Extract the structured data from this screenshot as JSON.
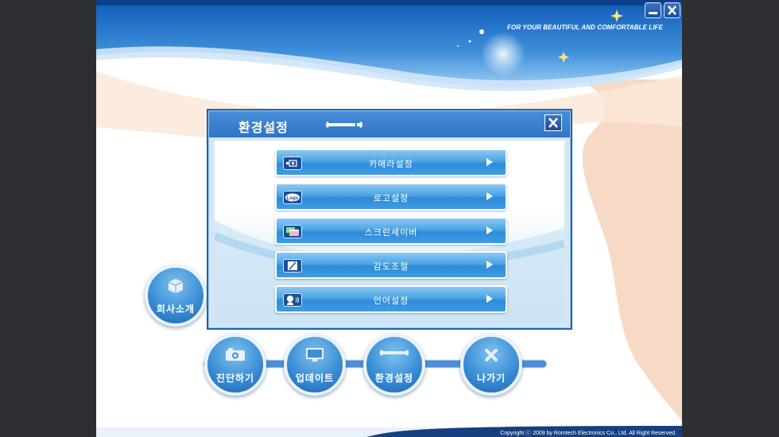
{
  "app": {
    "tagline": "FOR YOUR BEAUTIFUL AND COMFORTABLE LIFE",
    "copyright": "Copyright ⓒ 2009 by Romtech Electronics Co., Ltd.   All Right Reserved."
  },
  "window_controls": [
    {
      "name": "minimize",
      "icon": "minimize-icon"
    },
    {
      "name": "close",
      "icon": "close-icon"
    }
  ],
  "dialog": {
    "title": "환경설정",
    "title_icon": "wrench-icon",
    "close_icon": "close-icon",
    "items": [
      {
        "label": "카메라설정",
        "icon": "camera-setting-icon"
      },
      {
        "label": "로고설정",
        "icon": "logo-icon"
      },
      {
        "label": "스크린세이버",
        "icon": "screensaver-icon"
      },
      {
        "label": "감도조절",
        "icon": "sensitivity-icon"
      },
      {
        "label": "언어설정",
        "icon": "language-icon"
      }
    ]
  },
  "nav": {
    "company": {
      "label": "회사소개",
      "icon": "box-icon"
    },
    "items": [
      {
        "label": "진단하기",
        "icon": "camera-icon"
      },
      {
        "label": "업데이트",
        "icon": "monitor-icon"
      },
      {
        "label": "환경설정",
        "icon": "wrench-icon"
      },
      {
        "label": "나가기",
        "icon": "exit-icon"
      }
    ]
  },
  "colors": {
    "accent": "#2f8bd8",
    "header": "#1b63b6",
    "background_outer": "#2e2f33"
  }
}
